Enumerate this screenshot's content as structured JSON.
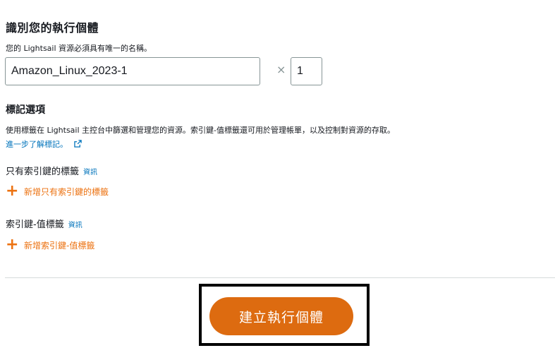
{
  "identify": {
    "title": "識別您的執行個體",
    "description": "您的 Lightsail 資源必須具有唯一的名稱。",
    "name_value": "Amazon_Linux_2023-1",
    "times_symbol": "×",
    "count_value": "1"
  },
  "tags": {
    "title": "標記選項",
    "description": "使用標籤在 Lightsail 主控台中篩選和管理您的資源。索引鍵-值標籤還可用於管理帳單，以及控制對資源的存取。",
    "learn_more": "進一步了解標記。",
    "key_only": {
      "label": "只有索引鍵的標籤",
      "info": "資訊",
      "add_label": "新增只有索引鍵的標籤"
    },
    "key_value": {
      "label": "索引鍵-值標籤",
      "info": "資訊",
      "add_label": "新增索引鍵-值標籤"
    }
  },
  "footer": {
    "create_button": "建立執行個體"
  },
  "colors": {
    "accent": "#ec7211",
    "button": "#dd6b10",
    "link": "#0073bb"
  }
}
